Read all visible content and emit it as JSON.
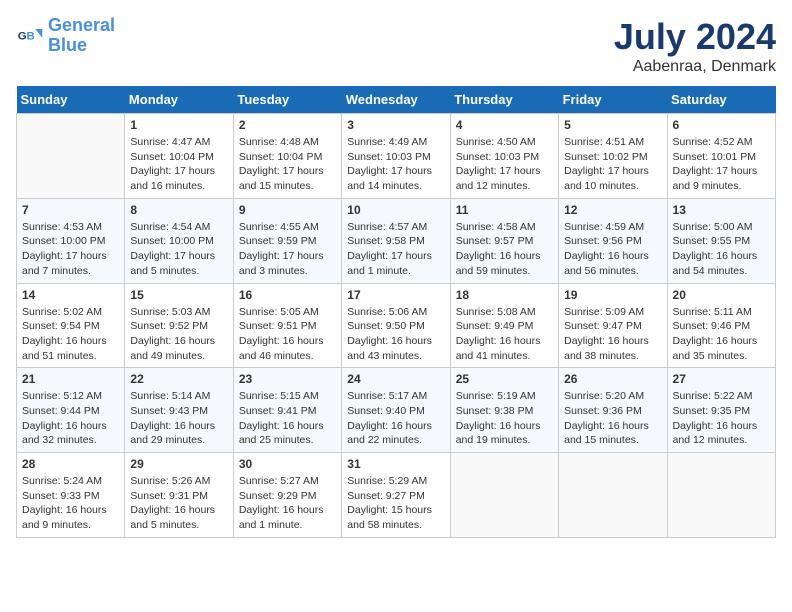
{
  "header": {
    "logo_line1": "General",
    "logo_line2": "Blue",
    "month": "July 2024",
    "location": "Aabenraa, Denmark"
  },
  "weekdays": [
    "Sunday",
    "Monday",
    "Tuesday",
    "Wednesday",
    "Thursday",
    "Friday",
    "Saturday"
  ],
  "weeks": [
    [
      {
        "day": "",
        "info": ""
      },
      {
        "day": "1",
        "info": "Sunrise: 4:47 AM\nSunset: 10:04 PM\nDaylight: 17 hours\nand 16 minutes."
      },
      {
        "day": "2",
        "info": "Sunrise: 4:48 AM\nSunset: 10:04 PM\nDaylight: 17 hours\nand 15 minutes."
      },
      {
        "day": "3",
        "info": "Sunrise: 4:49 AM\nSunset: 10:03 PM\nDaylight: 17 hours\nand 14 minutes."
      },
      {
        "day": "4",
        "info": "Sunrise: 4:50 AM\nSunset: 10:03 PM\nDaylight: 17 hours\nand 12 minutes."
      },
      {
        "day": "5",
        "info": "Sunrise: 4:51 AM\nSunset: 10:02 PM\nDaylight: 17 hours\nand 10 minutes."
      },
      {
        "day": "6",
        "info": "Sunrise: 4:52 AM\nSunset: 10:01 PM\nDaylight: 17 hours\nand 9 minutes."
      }
    ],
    [
      {
        "day": "7",
        "info": "Sunrise: 4:53 AM\nSunset: 10:00 PM\nDaylight: 17 hours\nand 7 minutes."
      },
      {
        "day": "8",
        "info": "Sunrise: 4:54 AM\nSunset: 10:00 PM\nDaylight: 17 hours\nand 5 minutes."
      },
      {
        "day": "9",
        "info": "Sunrise: 4:55 AM\nSunset: 9:59 PM\nDaylight: 17 hours\nand 3 minutes."
      },
      {
        "day": "10",
        "info": "Sunrise: 4:57 AM\nSunset: 9:58 PM\nDaylight: 17 hours\nand 1 minute."
      },
      {
        "day": "11",
        "info": "Sunrise: 4:58 AM\nSunset: 9:57 PM\nDaylight: 16 hours\nand 59 minutes."
      },
      {
        "day": "12",
        "info": "Sunrise: 4:59 AM\nSunset: 9:56 PM\nDaylight: 16 hours\nand 56 minutes."
      },
      {
        "day": "13",
        "info": "Sunrise: 5:00 AM\nSunset: 9:55 PM\nDaylight: 16 hours\nand 54 minutes."
      }
    ],
    [
      {
        "day": "14",
        "info": "Sunrise: 5:02 AM\nSunset: 9:54 PM\nDaylight: 16 hours\nand 51 minutes."
      },
      {
        "day": "15",
        "info": "Sunrise: 5:03 AM\nSunset: 9:52 PM\nDaylight: 16 hours\nand 49 minutes."
      },
      {
        "day": "16",
        "info": "Sunrise: 5:05 AM\nSunset: 9:51 PM\nDaylight: 16 hours\nand 46 minutes."
      },
      {
        "day": "17",
        "info": "Sunrise: 5:06 AM\nSunset: 9:50 PM\nDaylight: 16 hours\nand 43 minutes."
      },
      {
        "day": "18",
        "info": "Sunrise: 5:08 AM\nSunset: 9:49 PM\nDaylight: 16 hours\nand 41 minutes."
      },
      {
        "day": "19",
        "info": "Sunrise: 5:09 AM\nSunset: 9:47 PM\nDaylight: 16 hours\nand 38 minutes."
      },
      {
        "day": "20",
        "info": "Sunrise: 5:11 AM\nSunset: 9:46 PM\nDaylight: 16 hours\nand 35 minutes."
      }
    ],
    [
      {
        "day": "21",
        "info": "Sunrise: 5:12 AM\nSunset: 9:44 PM\nDaylight: 16 hours\nand 32 minutes."
      },
      {
        "day": "22",
        "info": "Sunrise: 5:14 AM\nSunset: 9:43 PM\nDaylight: 16 hours\nand 29 minutes."
      },
      {
        "day": "23",
        "info": "Sunrise: 5:15 AM\nSunset: 9:41 PM\nDaylight: 16 hours\nand 25 minutes."
      },
      {
        "day": "24",
        "info": "Sunrise: 5:17 AM\nSunset: 9:40 PM\nDaylight: 16 hours\nand 22 minutes."
      },
      {
        "day": "25",
        "info": "Sunrise: 5:19 AM\nSunset: 9:38 PM\nDaylight: 16 hours\nand 19 minutes."
      },
      {
        "day": "26",
        "info": "Sunrise: 5:20 AM\nSunset: 9:36 PM\nDaylight: 16 hours\nand 15 minutes."
      },
      {
        "day": "27",
        "info": "Sunrise: 5:22 AM\nSunset: 9:35 PM\nDaylight: 16 hours\nand 12 minutes."
      }
    ],
    [
      {
        "day": "28",
        "info": "Sunrise: 5:24 AM\nSunset: 9:33 PM\nDaylight: 16 hours\nand 9 minutes."
      },
      {
        "day": "29",
        "info": "Sunrise: 5:26 AM\nSunset: 9:31 PM\nDaylight: 16 hours\nand 5 minutes."
      },
      {
        "day": "30",
        "info": "Sunrise: 5:27 AM\nSunset: 9:29 PM\nDaylight: 16 hours\nand 1 minute."
      },
      {
        "day": "31",
        "info": "Sunrise: 5:29 AM\nSunset: 9:27 PM\nDaylight: 15 hours\nand 58 minutes."
      },
      {
        "day": "",
        "info": ""
      },
      {
        "day": "",
        "info": ""
      },
      {
        "day": "",
        "info": ""
      }
    ]
  ]
}
